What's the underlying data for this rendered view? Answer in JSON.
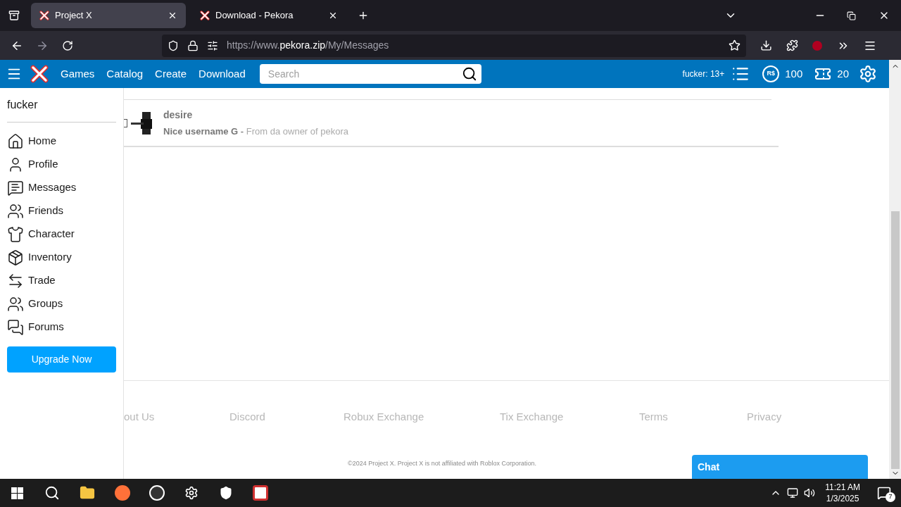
{
  "browser": {
    "tabs": [
      {
        "title": "Project X",
        "selected": true
      },
      {
        "title": "Download - Pekora",
        "selected": false
      }
    ],
    "url": {
      "scheme": "https://www.",
      "host": "pekora.zip",
      "path": "/My/Messages"
    }
  },
  "site_nav": {
    "links": [
      "Games",
      "Catalog",
      "Create",
      "Download"
    ],
    "search_placeholder": "Search",
    "user": "fucker: 13+",
    "robux_symbol": "R$",
    "robux": "100",
    "tix": "20"
  },
  "sidebar": {
    "username": "fucker",
    "items": [
      {
        "label": "Home",
        "kind": "home"
      },
      {
        "label": "Profile",
        "kind": "profile"
      },
      {
        "label": "Messages",
        "kind": "messages"
      },
      {
        "label": "Friends",
        "kind": "friends"
      },
      {
        "label": "Character",
        "kind": "character"
      },
      {
        "label": "Inventory",
        "kind": "inventory"
      },
      {
        "label": "Trade",
        "kind": "trade"
      },
      {
        "label": "Groups",
        "kind": "groups"
      },
      {
        "label": "Forums",
        "kind": "forums"
      }
    ],
    "upgrade": "Upgrade Now"
  },
  "messages": [
    {
      "sender": "desire",
      "subject": "Nice username G",
      "separator": " - ",
      "preview": "From da owner of pekora",
      "checked": false
    }
  ],
  "footer": {
    "links": [
      "out Us",
      "Discord",
      "Robux Exchange",
      "Tix Exchange",
      "Terms",
      "Privacy"
    ],
    "copyright": "©2024 Project X. Project X is not affiliated with Roblox Corporation."
  },
  "chat": {
    "title": "Chat"
  },
  "taskbar": {
    "time": "11:21 AM",
    "date": "1/3/2025",
    "notifications": "7"
  }
}
